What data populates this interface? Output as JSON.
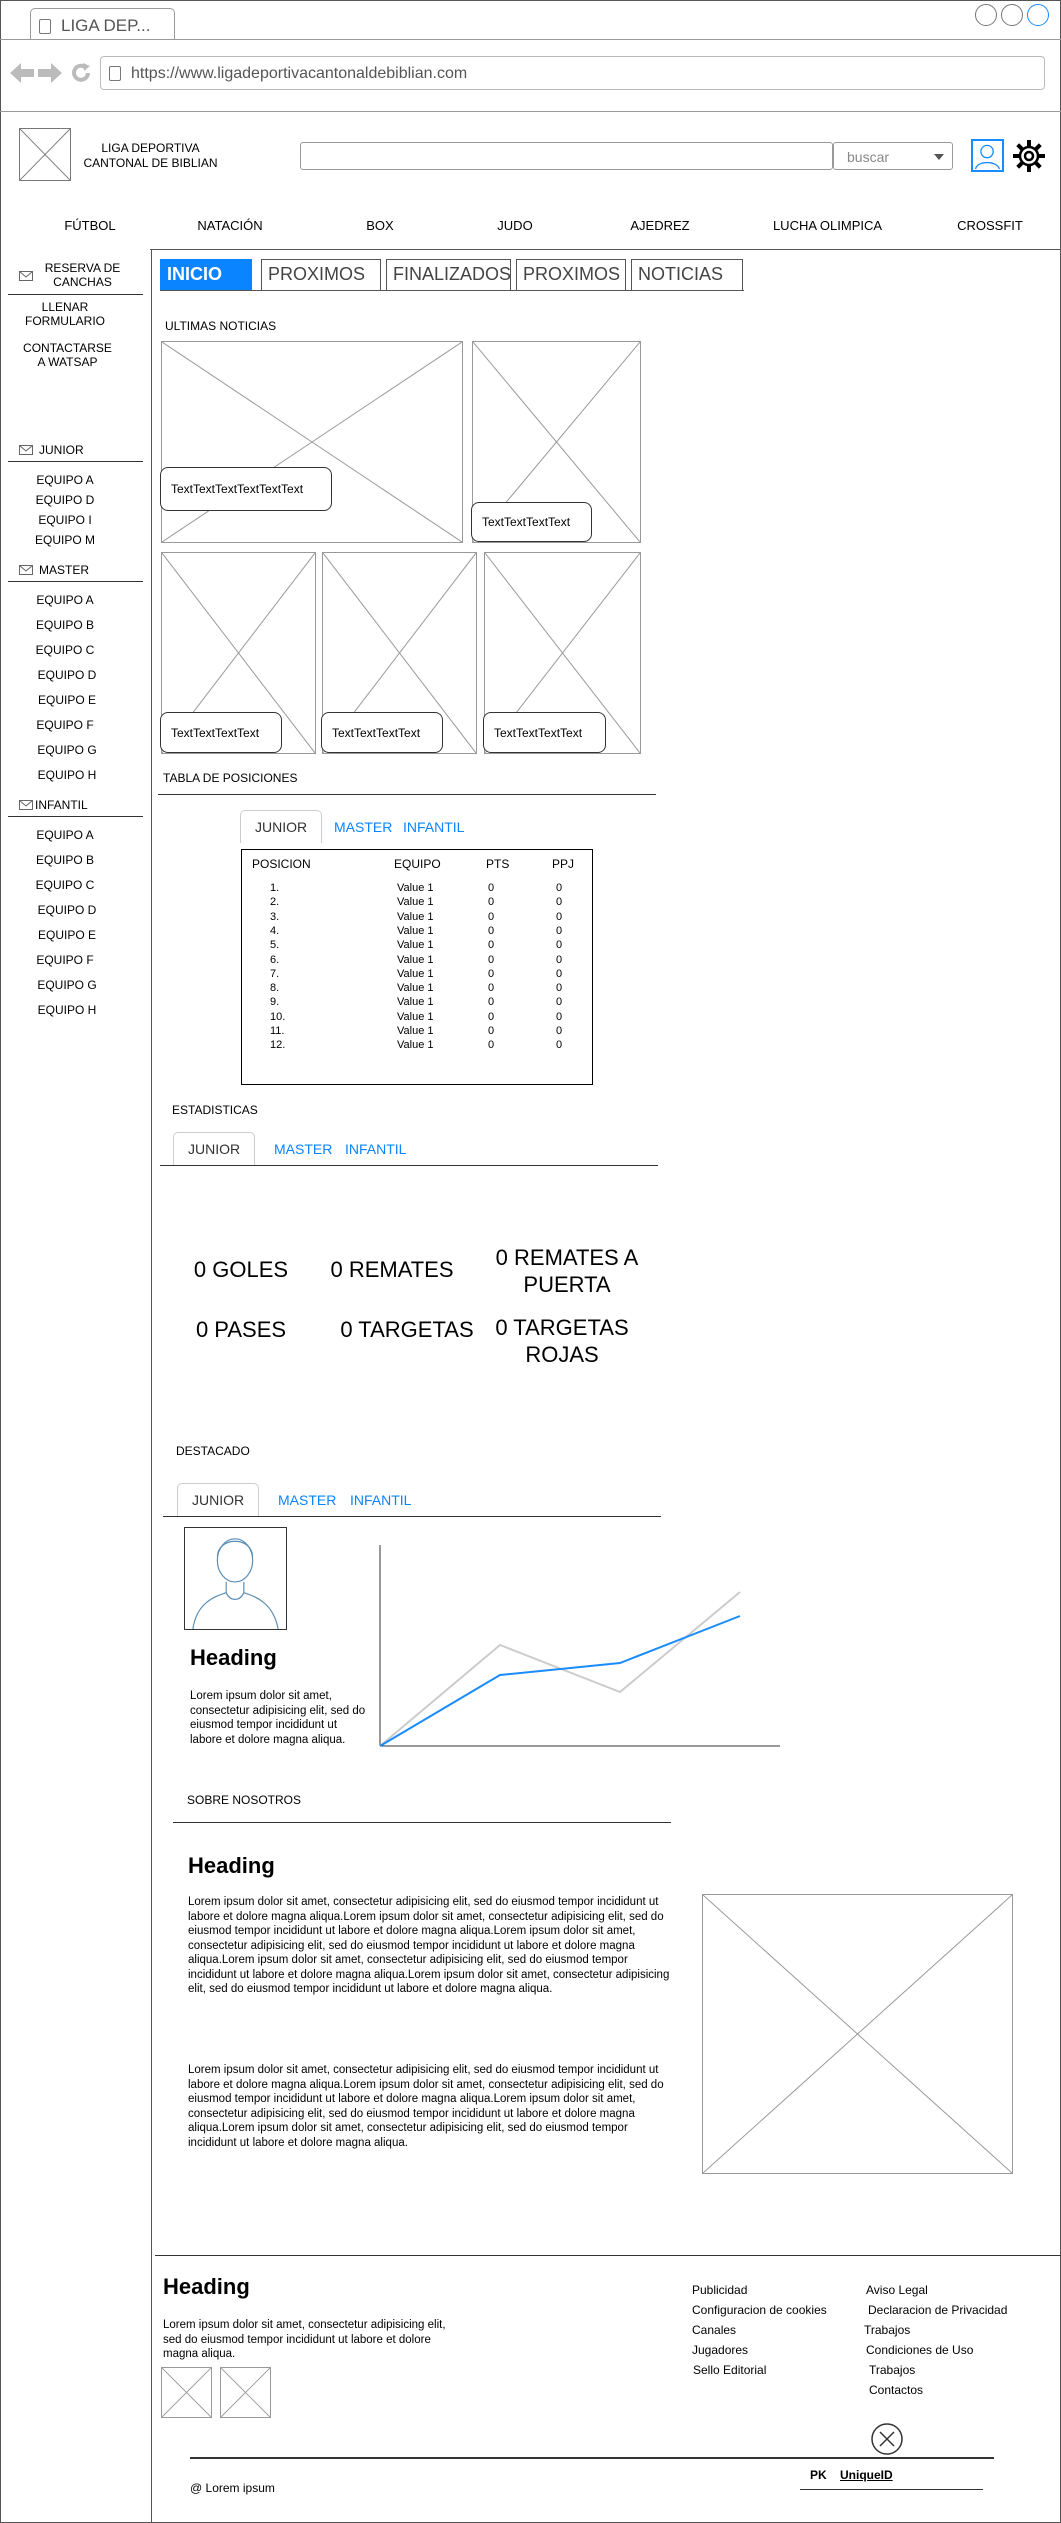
{
  "browser": {
    "tab_title": "LIGA DEP...",
    "url": "https://www.ligadeportivacantonaldebiblian.com"
  },
  "header": {
    "brand_line1": "LIGA DEPORTIVA",
    "brand_line2": "CANTONAL DE BIBLIAN",
    "search_value": "",
    "search_dropdown": "buscar"
  },
  "nav": [
    "FÚTBOL",
    "NATACIÓN",
    "BOX",
    "JUDO",
    "AJEDREZ",
    "LUCHA OLIMPICA",
    "CROSSFIT"
  ],
  "sidebar": {
    "reserva_line1": "RESERVA DE",
    "reserva_line2": "CANCHAS",
    "llenar_line1": "LLENAR",
    "llenar_line2": "FORMULARIO",
    "contactarse_line1": "CONTACTARSE",
    "contactarse_line2": "A WATSAP",
    "junior_label": "JUNIOR",
    "junior_items": [
      "EQUIPO A",
      "EQUIPO D",
      "EQUIPO I",
      "EQUIPO M"
    ],
    "master_label": "MASTER",
    "master_items": [
      "EQUIPO A",
      "EQUIPO B",
      "EQUIPO C",
      "EQUIPO D",
      "EQUIPO E",
      "EQUIPO F",
      "EQUIPO G",
      "EQUIPO H"
    ],
    "infantil_label": "INFANTIL",
    "infantil_items": [
      "EQUIPO A",
      "EQUIPO B",
      "EQUIPO C",
      "EQUIPO D",
      "EQUIPO E",
      "EQUIPO F",
      "EQUIPO G",
      "EQUIPO H"
    ]
  },
  "tabs": [
    "INICIO",
    "PROXIMOS",
    "FINALIZADOS",
    "PROXIMOS",
    "NOTICIAS"
  ],
  "news": {
    "title": "ULTIMAS NOTICIAS",
    "captions": [
      "TextTextTextTextTextText",
      "TextTextTextText",
      "TextTextTextText",
      "TextTextTextText",
      "TextTextTextText"
    ]
  },
  "standings": {
    "title": "TABLA DE POSICIONES",
    "tabs": [
      "JUNIOR",
      "MASTER",
      "INFANTIL"
    ],
    "columns": [
      "POSICION",
      "EQUIPO",
      "PTS",
      "PPJ"
    ],
    "rows": [
      [
        "1.",
        "Value 1",
        "0",
        "0"
      ],
      [
        "2.",
        "Value 1",
        "0",
        "0"
      ],
      [
        "3.",
        "Value 1",
        "0",
        "0"
      ],
      [
        "4.",
        "Value 1",
        "0",
        "0"
      ],
      [
        "5.",
        "Value 1",
        "0",
        "0"
      ],
      [
        "6.",
        "Value 1",
        "0",
        "0"
      ],
      [
        "7.",
        "Value 1",
        "0",
        "0"
      ],
      [
        "8.",
        "Value 1",
        "0",
        "0"
      ],
      [
        "9.",
        "Value 1",
        "0",
        "0"
      ],
      [
        "10.",
        "Value 1",
        "0",
        "0"
      ],
      [
        "11.",
        "Value 1",
        "0",
        "0"
      ],
      [
        "12.",
        "Value 1",
        "0",
        "0"
      ]
    ]
  },
  "stats": {
    "title": "ESTADISTICAS",
    "tabs": [
      "JUNIOR",
      "MASTER",
      "INFANTIL"
    ],
    "goles": "0 GOLES",
    "remates": "0 REMATES",
    "remates_puerta_1": "0 REMATES A",
    "remates_puerta_2": "PUERTA",
    "pases": "0 PASES",
    "targetas": "0 TARGETAS",
    "targetas_rojas_1": "0 TARGETAS",
    "targetas_rojas_2": "ROJAS"
  },
  "featured": {
    "title": "DESTACADO",
    "tabs": [
      "JUNIOR",
      "MASTER",
      "INFANTIL"
    ],
    "heading": "Heading",
    "text": "Lorem ipsum dolor sit amet, consectetur adipisicing elit, sed do eiusmod tempor incididunt ut labore et dolore magna aliqua."
  },
  "about": {
    "title": "SOBRE NOSOTROS",
    "heading": "Heading",
    "para1": "Lorem ipsum dolor sit amet, consectetur adipisicing elit, sed do eiusmod tempor incididunt ut labore et dolore magna aliqua.Lorem ipsum dolor sit amet, consectetur adipisicing elit, sed do eiusmod tempor incididunt ut labore et dolore magna aliqua.Lorem ipsum dolor sit amet, consectetur adipisicing elit, sed do eiusmod tempor incididunt ut labore et dolore magna aliqua.Lorem ipsum dolor sit amet, consectetur adipisicing elit, sed do eiusmod tempor incididunt ut labore et dolore magna aliqua.Lorem ipsum dolor sit amet, consectetur adipisicing elit, sed do eiusmod tempor incididunt ut labore et dolore magna aliqua.",
    "para2": "Lorem ipsum dolor sit amet, consectetur adipisicing elit, sed do eiusmod tempor incididunt ut labore et dolore magna aliqua.Lorem ipsum dolor sit amet, consectetur adipisicing elit, sed do eiusmod tempor incididunt ut labore et dolore magna aliqua.Lorem ipsum dolor sit amet, consectetur adipisicing elit, sed do eiusmod tempor incididunt ut labore et dolore magna aliqua.Lorem ipsum dolor sit amet, consectetur adipisicing elit, sed do eiusmod tempor incididunt ut labore et dolore magna aliqua."
  },
  "footer": {
    "heading": "Heading",
    "text": "Lorem ipsum dolor sit amet, consectetur adipisicing elit, sed do eiusmod tempor incididunt ut labore et dolore magna aliqua.",
    "links_col1": [
      "Publicidad",
      "Configuracion de cookies",
      "Canales",
      "Jugadores",
      "Sello Editorial"
    ],
    "links_col2": [
      "Aviso Legal",
      "Declaracion de Privacidad",
      "Trabajos",
      "Condiciones de Uso",
      "Trabajos",
      "Contactos"
    ],
    "copyright": "@ Lorem ipsum",
    "pk": "PK",
    "unique_id": "UniqueID"
  },
  "colors": {
    "accent": "#0a84ff",
    "line": "#333333",
    "placeholder": "#999999"
  }
}
